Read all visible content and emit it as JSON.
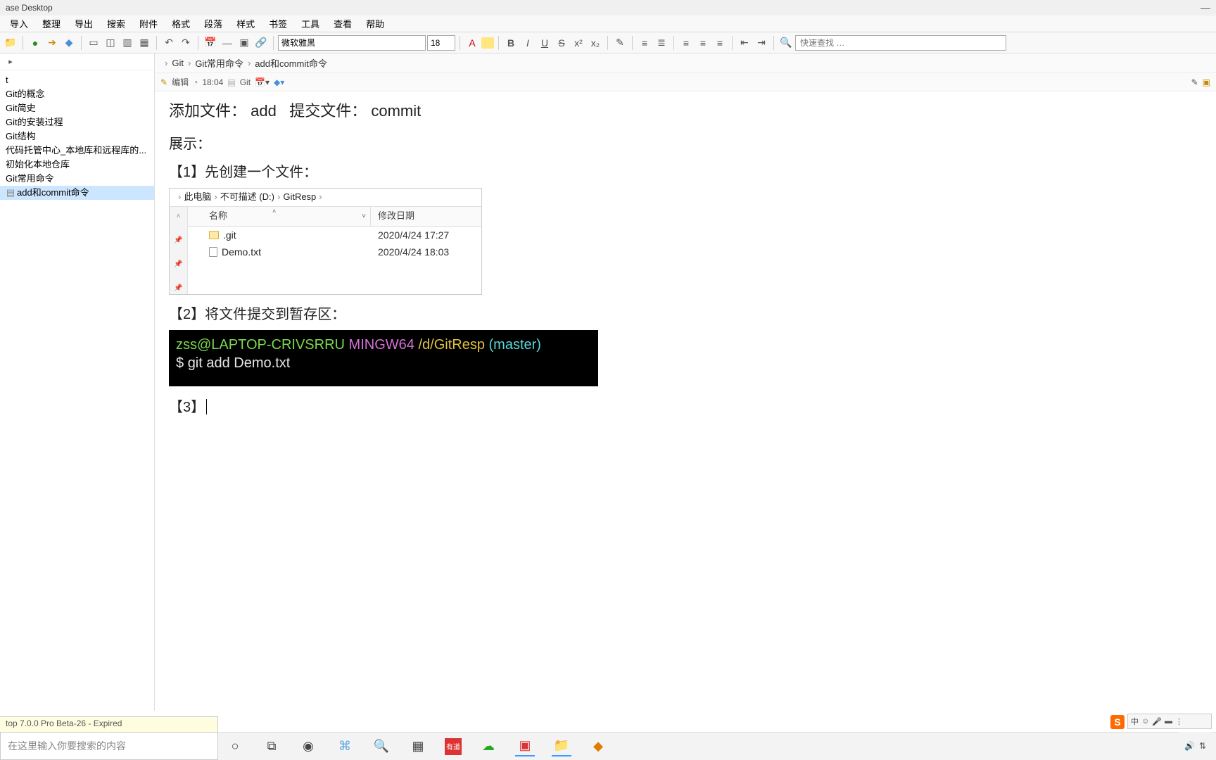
{
  "window": {
    "title": "ase Desktop",
    "version_status": "top 7.0.0 Pro Beta-26 - Expired"
  },
  "menu": [
    "导入",
    "整理",
    "导出",
    "搜索",
    "附件",
    "格式",
    "段落",
    "样式",
    "书签",
    "工具",
    "查看",
    "帮助"
  ],
  "toolbar": {
    "font": "微软雅黑",
    "font_size": "18",
    "search_placeholder": "快速查找 …"
  },
  "sidebar": {
    "root": "t",
    "items": [
      {
        "label": "Git的概念"
      },
      {
        "label": "Git简史"
      },
      {
        "label": "Git的安装过程"
      },
      {
        "label": "Git结构"
      },
      {
        "label": "代码托管中心_本地库和远程库的..."
      },
      {
        "label": "初始化本地仓库"
      },
      {
        "label": "Git常用命令"
      },
      {
        "label": "add和commit命令",
        "selected": true,
        "icon": "file"
      }
    ]
  },
  "breadcrumb": [
    "Git",
    "Git常用命令",
    "add和commit命令"
  ],
  "note_status": {
    "mode": "编辑",
    "time": "18:04",
    "book": "Git"
  },
  "doc": {
    "title_left": "添加文件：",
    "title_add": "add",
    "title_mid": "提交文件：",
    "title_commit": "commit",
    "section": "展示：",
    "step1": "【1】先创建一个文件：",
    "step2": "【2】将文件提交到暂存区：",
    "step3": "【3】"
  },
  "explorer": {
    "crumbs": [
      "此电脑",
      "不可描述 (D:)",
      "GitResp"
    ],
    "headers": {
      "name": "名称",
      "date": "修改日期"
    },
    "rows": [
      {
        "name": ".git",
        "type": "folder",
        "date": "2020/4/24 17:27"
      },
      {
        "name": "Demo.txt",
        "type": "file",
        "date": "2020/4/24 18:03"
      }
    ]
  },
  "terminal": {
    "user": "zss@LAPTOP-CRIVSRRU",
    "shell": "MINGW64",
    "path": "/d/GitResp",
    "branch": "(master)",
    "prompt": "$",
    "cmd": "git add Demo.txt"
  },
  "win_search": {
    "placeholder": "在这里输入你要搜索的内容"
  },
  "ime": {
    "label": "中"
  }
}
